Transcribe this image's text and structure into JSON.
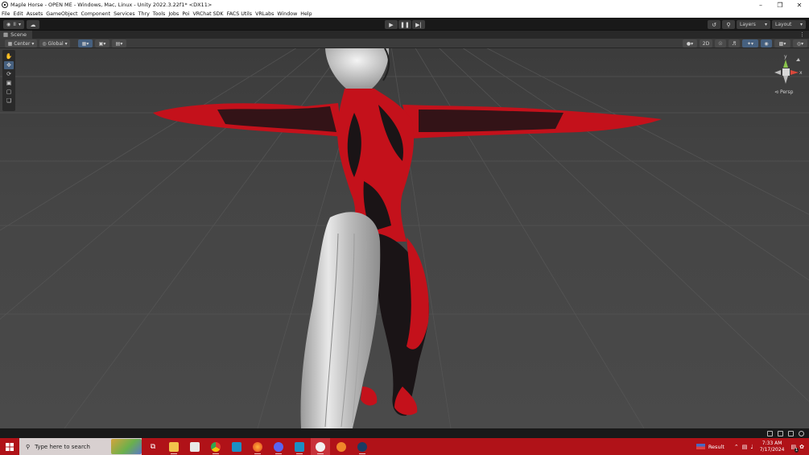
{
  "window": {
    "title": "Maple Horse - OPEN ME - Windows, Mac, Linux - Unity 2022.3.22f1* <DX11>",
    "minimize_icon": "minimize-icon",
    "restore_icon": "restore-icon",
    "close_icon": "close-icon"
  },
  "menu": [
    "File",
    "Edit",
    "Assets",
    "GameObject",
    "Component",
    "Services",
    "Thry",
    "Tools",
    "Jobs",
    "Poi",
    "VRChat SDK",
    "FACS Utils",
    "VRLabs",
    "Window",
    "Help"
  ],
  "toolbar": {
    "account_label": "II",
    "play_icon": "play-icon",
    "pause_icon": "pause-icon",
    "step_icon": "step-icon",
    "layers_label": "Layers",
    "layout_label": "Layout"
  },
  "scene_tab": {
    "label": "Scene"
  },
  "scene_toolbar": {
    "pivot_label": "Center",
    "space_label": "Global",
    "mode_2d_label": "2D"
  },
  "gizmo": {
    "y_label": "y",
    "x_label": "x",
    "projection_label": "Persp"
  },
  "taskbar": {
    "search_placeholder": "Type here to search",
    "weather_label": "Result",
    "time": "7:33 AM",
    "date": "7/17/2024",
    "notification_count": "1"
  },
  "colors": {
    "viewport_bg": "#474747",
    "editor_dark": "#191919",
    "taskbar_red": "#b01218",
    "accent_blue": "#46607f",
    "model_red": "#c4111b",
    "model_black": "#1a1416"
  }
}
